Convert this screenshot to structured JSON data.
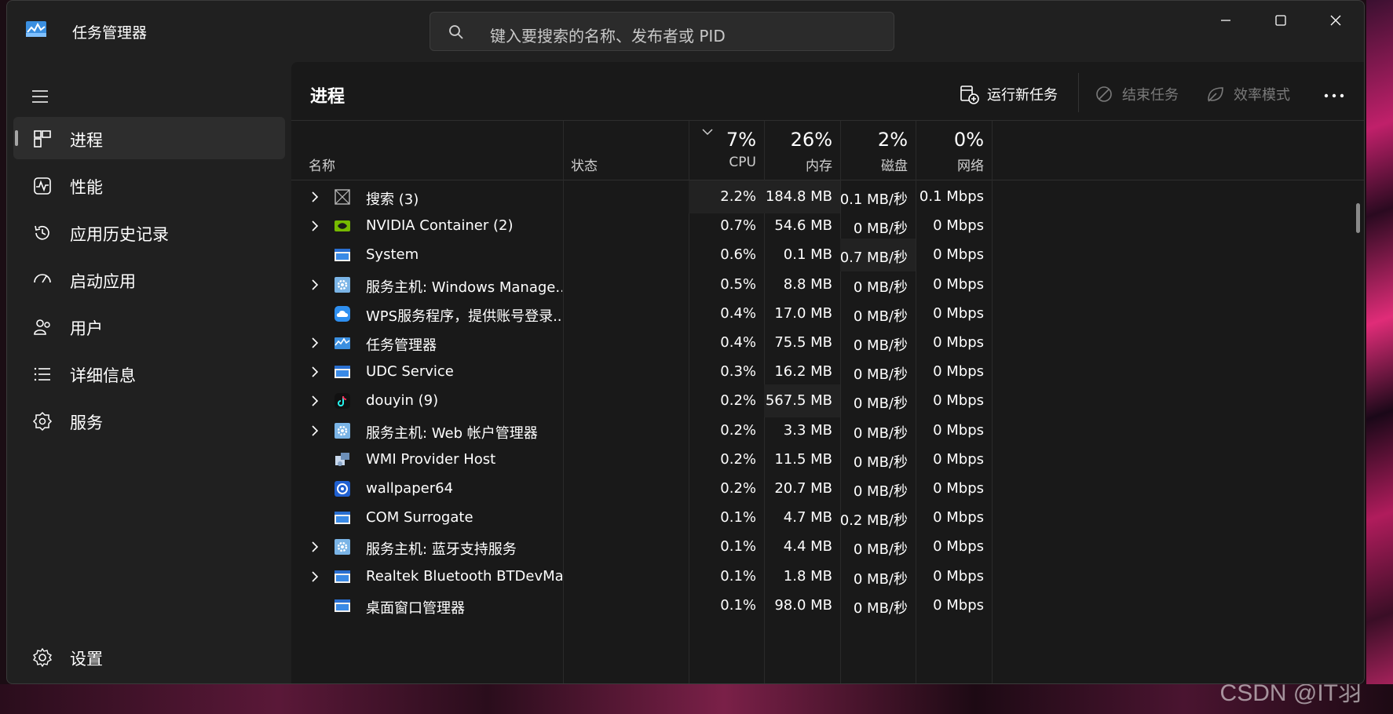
{
  "app": {
    "title": "任务管理器",
    "search_placeholder": "键入要搜索的名称、发布者或 PID"
  },
  "sidebar": {
    "items": [
      {
        "label": "进程",
        "icon": "processes-icon",
        "active": true
      },
      {
        "label": "性能",
        "icon": "performance-icon"
      },
      {
        "label": "应用历史记录",
        "icon": "app-history-icon"
      },
      {
        "label": "启动应用",
        "icon": "startup-apps-icon"
      },
      {
        "label": "用户",
        "icon": "users-icon"
      },
      {
        "label": "详细信息",
        "icon": "details-icon"
      },
      {
        "label": "服务",
        "icon": "services-icon"
      }
    ],
    "settings_label": "设置"
  },
  "main": {
    "title": "进程",
    "toolbar": {
      "run_new_task": "运行新任务",
      "end_task": "结束任务",
      "efficiency_mode": "效率模式"
    },
    "columns": {
      "name": "名称",
      "status": "状态",
      "cpu": {
        "pct": "7%",
        "label": "CPU"
      },
      "memory": {
        "pct": "26%",
        "label": "内存"
      },
      "disk": {
        "pct": "2%",
        "label": "磁盘"
      },
      "network": {
        "pct": "0%",
        "label": "网络"
      }
    },
    "rows": [
      {
        "name": "搜索 (3)",
        "icon": "search-app-icon",
        "expandable": true,
        "cpu": "2.2%",
        "memory": "184.8 MB",
        "disk": "0.1 MB/秒",
        "network": "0.1 Mbps"
      },
      {
        "name": "NVIDIA Container (2)",
        "icon": "nvidia-icon",
        "expandable": true,
        "cpu": "0.7%",
        "memory": "54.6 MB",
        "disk": "0 MB/秒",
        "network": "0 Mbps"
      },
      {
        "name": "System",
        "icon": "window-app-icon",
        "expandable": false,
        "cpu": "0.6%",
        "memory": "0.1 MB",
        "disk": "0.7 MB/秒",
        "network": "0 Mbps"
      },
      {
        "name": "服务主机: Windows Manage...",
        "icon": "gear-service-icon",
        "expandable": true,
        "cpu": "0.5%",
        "memory": "8.8 MB",
        "disk": "0 MB/秒",
        "network": "0 Mbps"
      },
      {
        "name": "WPS服务程序，提供账号登录...",
        "icon": "wps-cloud-icon",
        "expandable": false,
        "cpu": "0.4%",
        "memory": "17.0 MB",
        "disk": "0 MB/秒",
        "network": "0 Mbps"
      },
      {
        "name": "任务管理器",
        "icon": "task-manager-icon",
        "expandable": true,
        "cpu": "0.4%",
        "memory": "75.5 MB",
        "disk": "0 MB/秒",
        "network": "0 Mbps"
      },
      {
        "name": "UDC Service",
        "icon": "window-app-icon",
        "expandable": true,
        "cpu": "0.3%",
        "memory": "16.2 MB",
        "disk": "0 MB/秒",
        "network": "0 Mbps"
      },
      {
        "name": "douyin (9)",
        "icon": "douyin-icon",
        "expandable": true,
        "cpu": "0.2%",
        "memory": "567.5 MB",
        "disk": "0 MB/秒",
        "network": "0 Mbps"
      },
      {
        "name": "服务主机: Web 帐户管理器",
        "icon": "gear-service-icon",
        "expandable": true,
        "cpu": "0.2%",
        "memory": "3.3 MB",
        "disk": "0 MB/秒",
        "network": "0 Mbps"
      },
      {
        "name": "WMI Provider Host",
        "icon": "wmi-icon",
        "expandable": false,
        "cpu": "0.2%",
        "memory": "11.5 MB",
        "disk": "0 MB/秒",
        "network": "0 Mbps"
      },
      {
        "name": "wallpaper64",
        "icon": "wallpaper-icon",
        "expandable": false,
        "cpu": "0.2%",
        "memory": "20.7 MB",
        "disk": "0 MB/秒",
        "network": "0 Mbps"
      },
      {
        "name": "COM Surrogate",
        "icon": "window-app-icon",
        "expandable": false,
        "cpu": "0.1%",
        "memory": "4.7 MB",
        "disk": "0.2 MB/秒",
        "network": "0 Mbps"
      },
      {
        "name": "服务主机: 蓝牙支持服务",
        "icon": "gear-service-icon",
        "expandable": true,
        "cpu": "0.1%",
        "memory": "4.4 MB",
        "disk": "0 MB/秒",
        "network": "0 Mbps"
      },
      {
        "name": "Realtek Bluetooth BTDevMa...",
        "icon": "window-app-icon",
        "expandable": true,
        "cpu": "0.1%",
        "memory": "1.8 MB",
        "disk": "0 MB/秒",
        "network": "0 Mbps"
      },
      {
        "name": "桌面窗口管理器",
        "icon": "window-app-icon",
        "expandable": false,
        "cpu": "0.1%",
        "memory": "98.0 MB",
        "disk": "0 MB/秒",
        "network": "0 Mbps"
      }
    ]
  },
  "watermark": "CSDN @IT羽",
  "colors": {
    "window_bg": "#202020",
    "panel_bg": "#191919",
    "active_nav": "#2d2d2d",
    "text": "#ffffff",
    "muted_text": "#7a7a7a"
  }
}
